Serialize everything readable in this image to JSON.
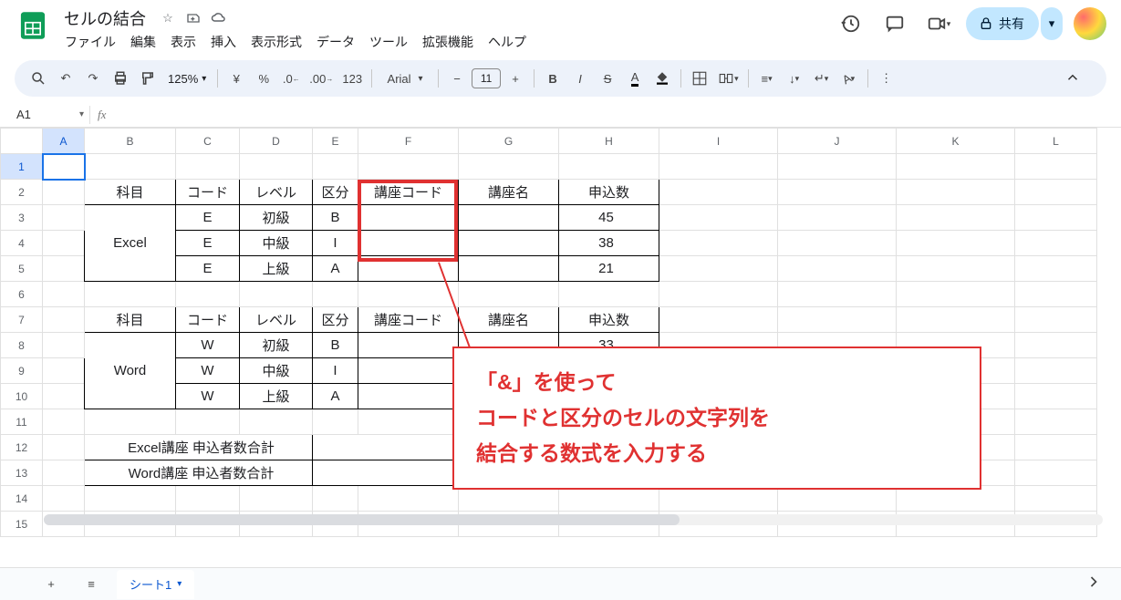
{
  "doc": {
    "title": "セルの結合"
  },
  "menus": [
    "ファイル",
    "編集",
    "表示",
    "挿入",
    "表示形式",
    "データ",
    "ツール",
    "拡張機能",
    "ヘルプ"
  ],
  "toolbar": {
    "zoom": "125%",
    "font": "Arial",
    "fontSize": "11"
  },
  "share": {
    "label": "共有"
  },
  "namebox": "A1",
  "columns": [
    "",
    "A",
    "B",
    "C",
    "D",
    "E",
    "F",
    "G",
    "H",
    "I",
    "J",
    "K",
    "L"
  ],
  "rows": [
    1,
    2,
    3,
    4,
    5,
    6,
    7,
    8,
    9,
    10,
    11,
    12,
    13,
    14,
    15
  ],
  "t1": {
    "headers": [
      "科目",
      "コード",
      "レベル",
      "区分",
      "講座コード",
      "講座名",
      "申込数"
    ],
    "subject": "Excel",
    "rows": [
      {
        "code": "E",
        "level": "初級",
        "kubun": "B",
        "apply": 45
      },
      {
        "code": "E",
        "level": "中級",
        "kubun": "I",
        "apply": 38
      },
      {
        "code": "E",
        "level": "上級",
        "kubun": "A",
        "apply": 21
      }
    ]
  },
  "t2": {
    "headers": [
      "科目",
      "コード",
      "レベル",
      "区分",
      "講座コード",
      "講座名",
      "申込数"
    ],
    "subject": "Word",
    "rows": [
      {
        "code": "W",
        "level": "初級",
        "kubun": "B",
        "apply": 33
      },
      {
        "code": "W",
        "level": "中級",
        "kubun": "I",
        "apply": ""
      },
      {
        "code": "W",
        "level": "上級",
        "kubun": "A",
        "apply": ""
      }
    ]
  },
  "totals": {
    "excel": "Excel講座 申込者数合計",
    "word": "Word講座 申込者数合計"
  },
  "callout": {
    "line1": "「&」を使って",
    "line2": "コードと区分のセルの文字列を",
    "line3": "結合する数式を入力する"
  },
  "sheet": {
    "name": "シート1"
  }
}
